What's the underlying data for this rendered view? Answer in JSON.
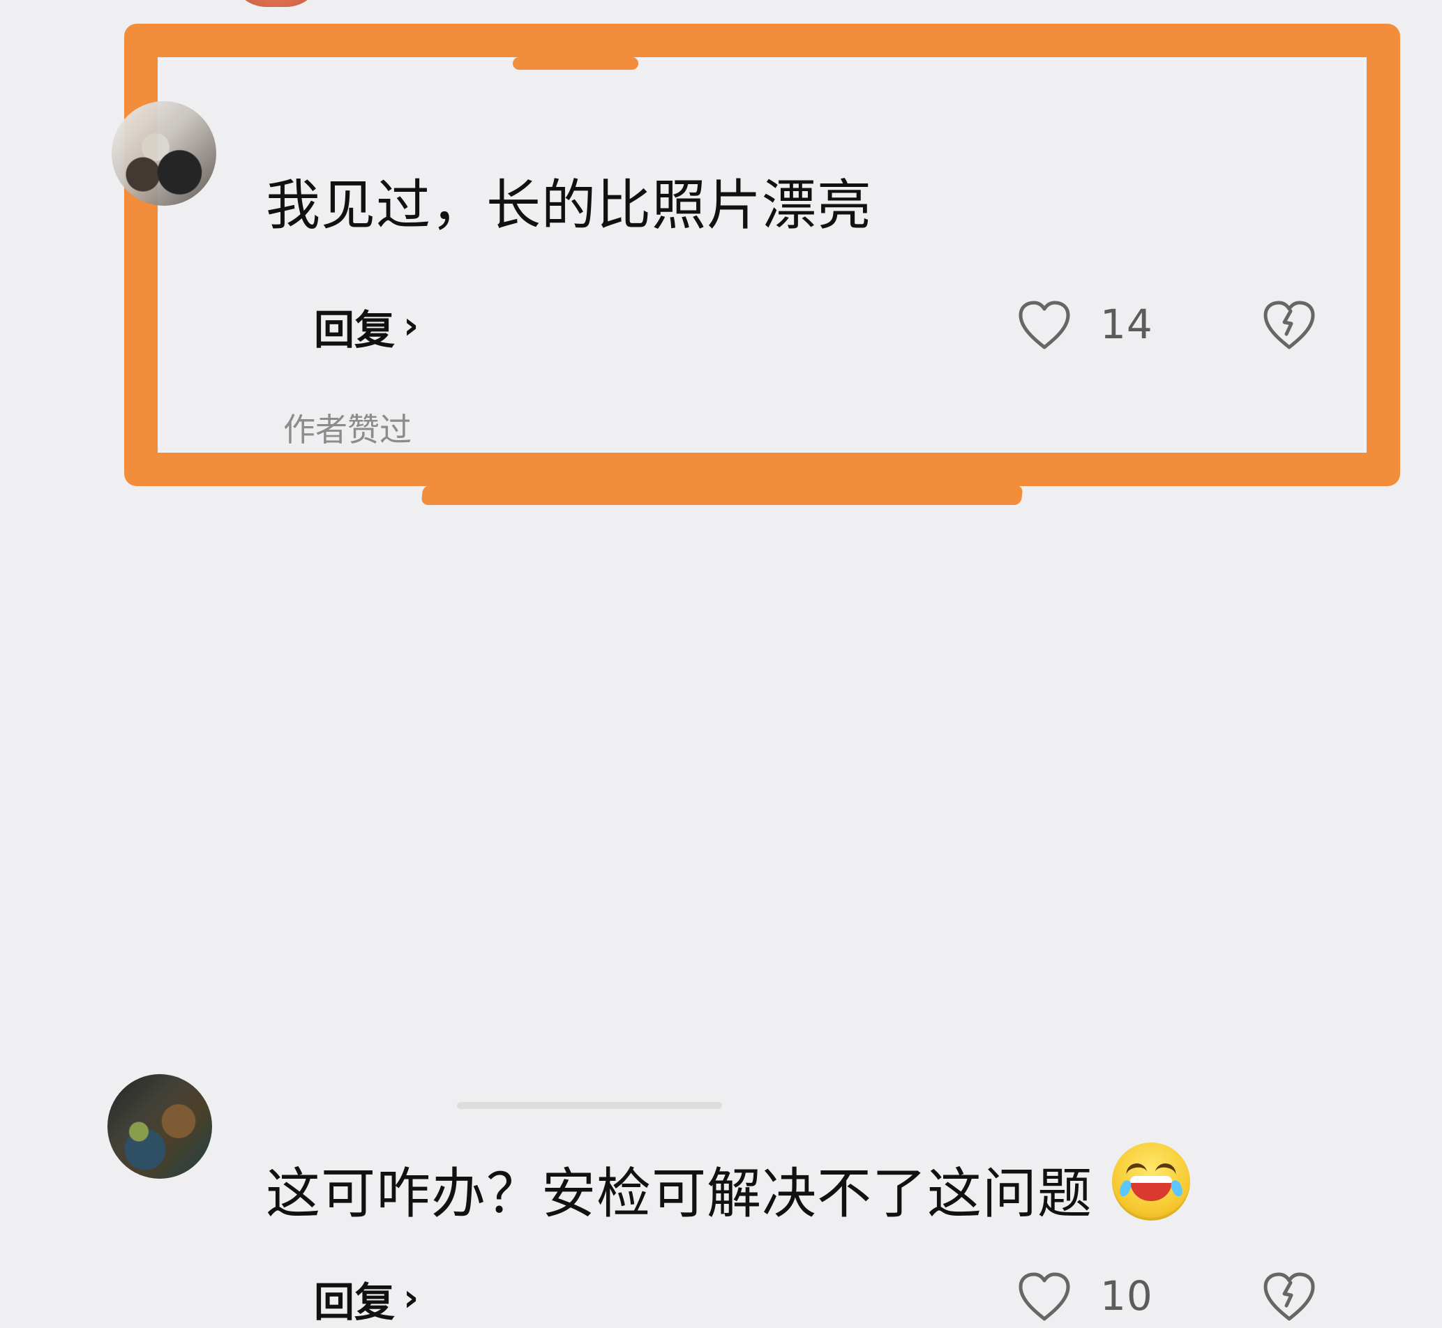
{
  "comments": [
    {
      "text": "我见过，长的比照片漂亮",
      "reply_label": "回复",
      "reply_chevron": "›",
      "likes": "14",
      "author_liked_label": "作者赞过",
      "avatar_icon": "avatar-icon",
      "heart_icon": "heart-icon",
      "dislike_icon": "broken-heart-icon"
    },
    {
      "text": "这可咋办？安检可解决不了这问题",
      "reply_label": "回复",
      "reply_chevron": "›",
      "likes": "10",
      "avatar_icon": "avatar-icon",
      "emoji_icon": "laughing-tears-emoji-icon",
      "heart_icon": "heart-icon",
      "dislike_icon": "broken-heart-icon"
    }
  ],
  "colors": {
    "background": "#efeff1",
    "highlight": "#f28d3c",
    "text": "#111111",
    "secondary_text": "#5c5c5c",
    "muted_text": "#8c8c8c"
  }
}
